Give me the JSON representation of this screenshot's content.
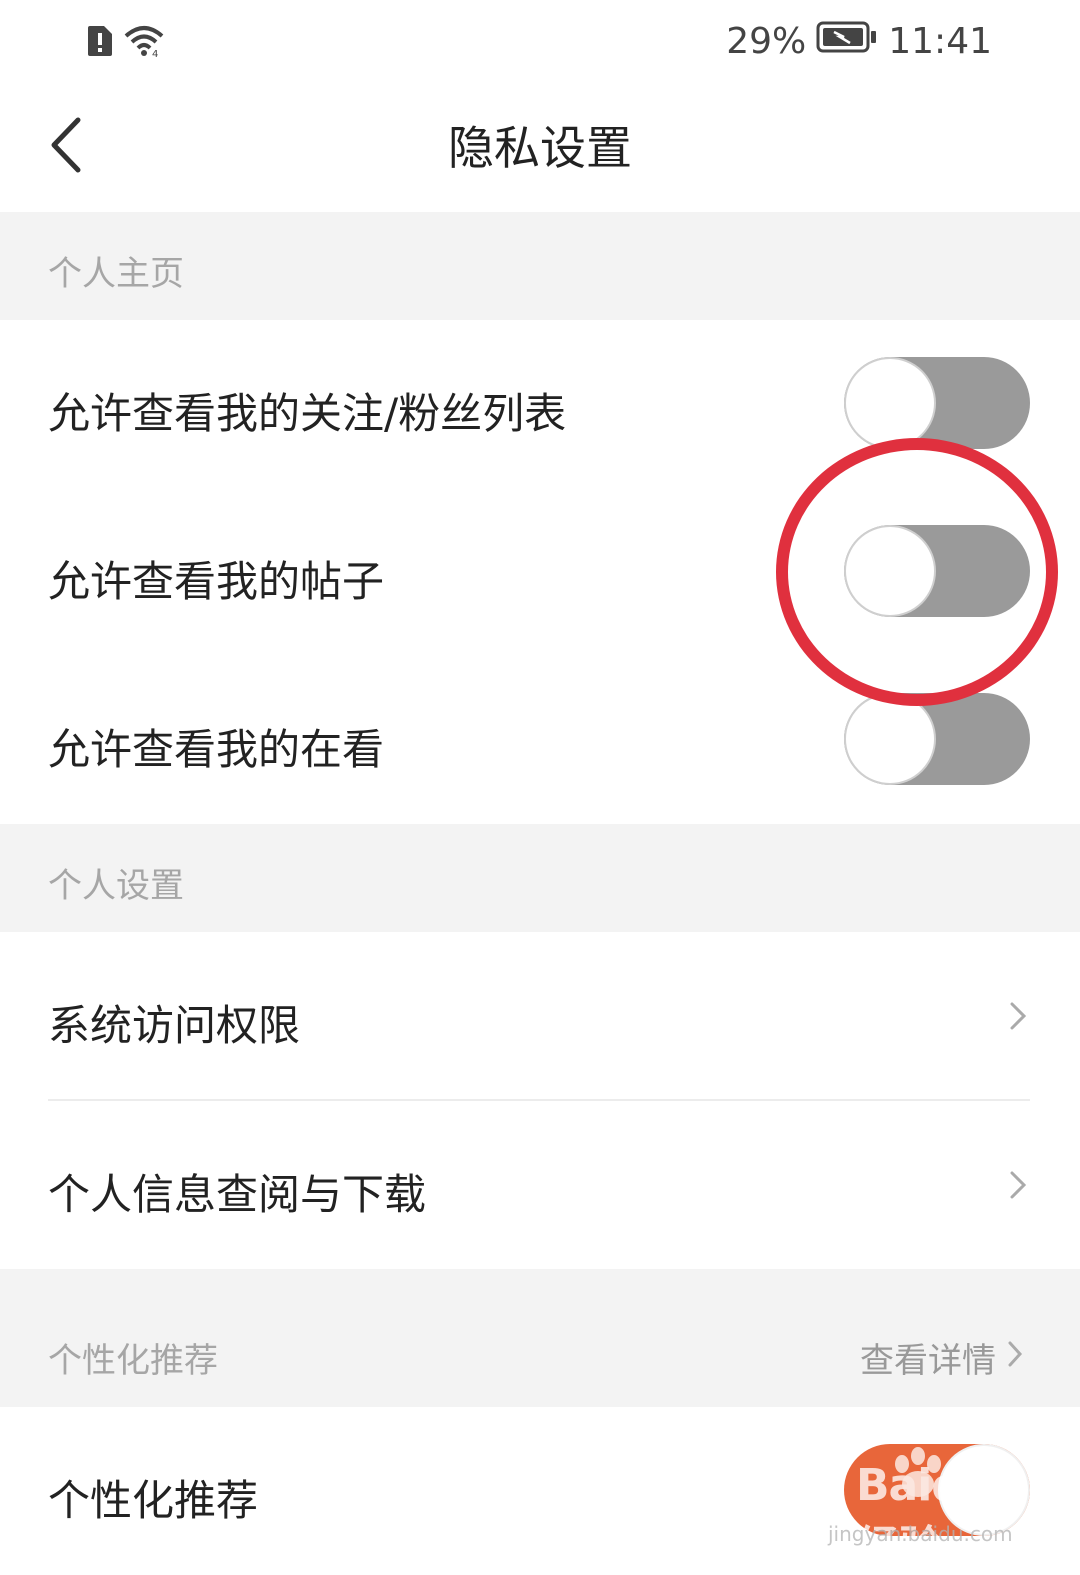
{
  "status_bar": {
    "battery_percent": "29%",
    "time": "11:41",
    "icons": [
      "sim-alert-icon",
      "wifi-icon",
      "battery-charging-icon"
    ]
  },
  "header": {
    "title": "隐私设置",
    "back_icon": "chevron-left-icon"
  },
  "sections": {
    "homepage": {
      "title": "个人主页",
      "items": [
        {
          "label": "允许查看我的关注/粉丝列表",
          "toggle_on": false
        },
        {
          "label": "允许查看我的帖子",
          "toggle_on": false
        },
        {
          "label": "允许查看我的在看",
          "toggle_on": false
        }
      ]
    },
    "personal_settings": {
      "title": "个人设置",
      "items": [
        {
          "label": "系统访问权限"
        },
        {
          "label": "个人信息查阅与下载"
        }
      ]
    },
    "recommendation": {
      "title": "个性化推荐",
      "detail_label": "查看详情",
      "items": [
        {
          "label": "个性化推荐",
          "toggle_on": true
        }
      ]
    }
  },
  "watermark": {
    "logo_text": "Baidu经验",
    "url": "jingyan.baidu.com"
  },
  "colors": {
    "accent": "#e8663a",
    "toggle_off": "#9a9a9a",
    "section_bg": "#f3f3f3",
    "highlight": "#e0303e"
  }
}
